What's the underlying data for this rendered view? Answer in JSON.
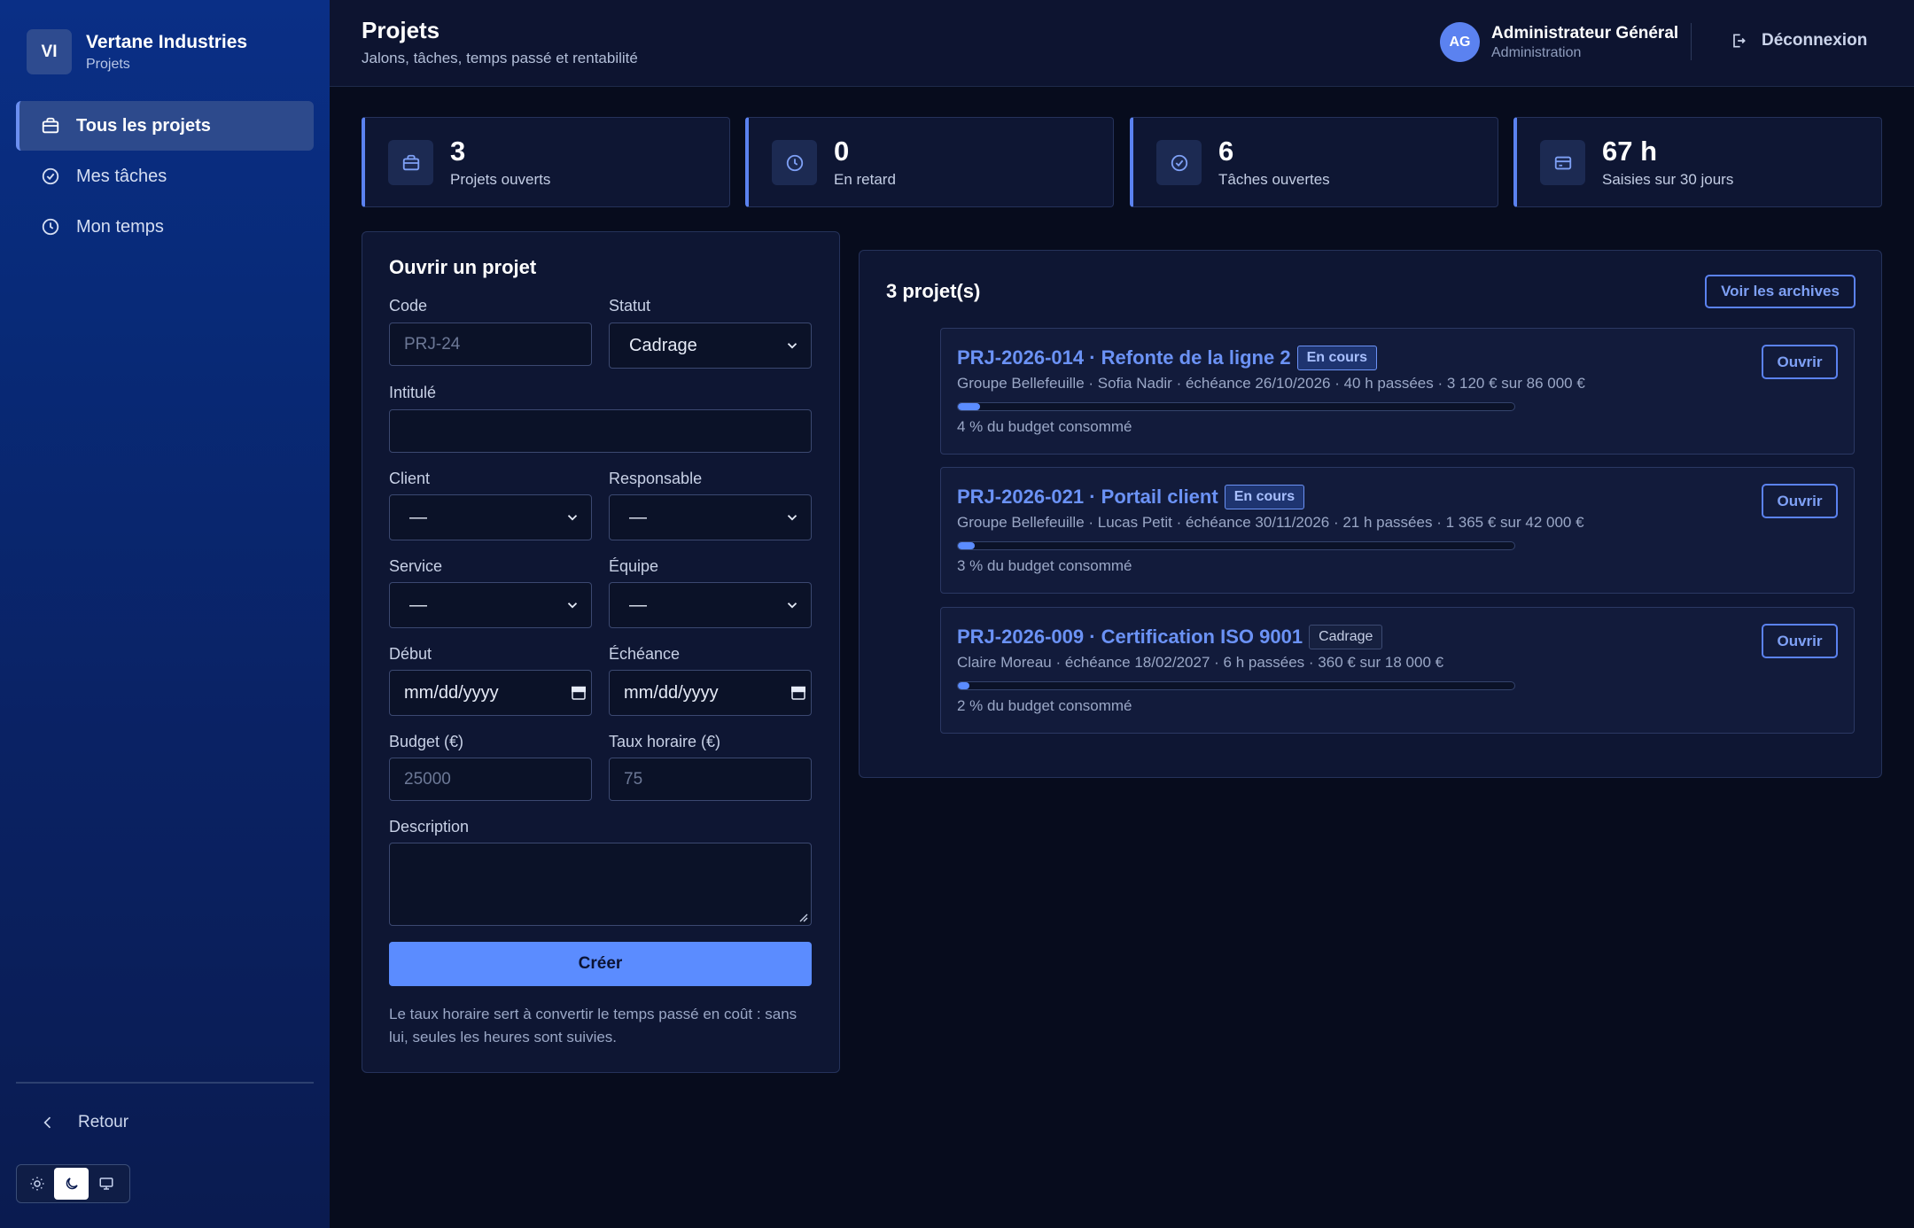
{
  "brand": {
    "initials": "VI",
    "name": "Vertane Industries",
    "subtitle": "Projets"
  },
  "sidebar": {
    "items": [
      {
        "label": "Tous les projets",
        "icon": "briefcase-icon",
        "active": true
      },
      {
        "label": "Mes tâches",
        "icon": "check-circle-icon",
        "active": false
      },
      {
        "label": "Mon temps",
        "icon": "clock-icon",
        "active": false
      }
    ],
    "back_label": "Retour",
    "theme": {
      "options": [
        "sun-icon",
        "moon-icon",
        "monitor-icon"
      ],
      "selected": "moon-icon"
    }
  },
  "header": {
    "title": "Projets",
    "subtitle": "Jalons, tâches, temps passé et rentabilité",
    "user": {
      "initials": "AG",
      "name": "Administrateur Général",
      "role": "Administration"
    },
    "logout_label": "Déconnexion"
  },
  "stats": [
    {
      "value": "3",
      "label": "Projets ouverts",
      "icon": "briefcase-icon"
    },
    {
      "value": "0",
      "label": "En retard",
      "icon": "clock-icon"
    },
    {
      "value": "6",
      "label": "Tâches ouvertes",
      "icon": "check-circle-icon"
    },
    {
      "value": "67 h",
      "label": "Saisies sur 30 jours",
      "icon": "card-icon"
    }
  ],
  "form": {
    "title": "Ouvrir un projet",
    "code": {
      "label": "Code",
      "placeholder": "PRJ-24",
      "value": ""
    },
    "status": {
      "label": "Statut",
      "value": "Cadrage"
    },
    "title_field": {
      "label": "Intitulé",
      "value": ""
    },
    "client": {
      "label": "Client",
      "value": "—"
    },
    "manager": {
      "label": "Responsable",
      "value": "—"
    },
    "service": {
      "label": "Service",
      "value": "—"
    },
    "team": {
      "label": "Équipe",
      "value": "—"
    },
    "start": {
      "label": "Début",
      "placeholder": "mm/dd/yyyy"
    },
    "due": {
      "label": "Échéance",
      "placeholder": "mm/dd/yyyy"
    },
    "budget": {
      "label": "Budget (€)",
      "placeholder": "25000"
    },
    "rate": {
      "label": "Taux horaire (€)",
      "placeholder": "75"
    },
    "description": {
      "label": "Description",
      "value": ""
    },
    "submit_label": "Créer",
    "note": "Le taux horaire sert à convertir le temps passé en coût : sans lui, seules les heures sont suivies."
  },
  "projects": {
    "count_label": "3 projet(s)",
    "archive_label": "Voir les archives",
    "open_label": "Ouvrir",
    "accent": "#5b8cff",
    "items": [
      {
        "title": "PRJ-2026-014 · Refonte de la ligne 2",
        "status": "En cours",
        "meta": "Groupe Bellefeuille · Sofia Nadir · échéance 26/10/2026 · 40 h passées · 3 120 € sur 86 000 €",
        "progress": 4,
        "budget_text": "4 % du budget consommé"
      },
      {
        "title": "PRJ-2026-021 · Portail client",
        "status": "En cours",
        "meta": "Groupe Bellefeuille · Lucas Petit · échéance 30/11/2026 · 21 h passées · 1 365 € sur 42 000 €",
        "progress": 3,
        "budget_text": "3 % du budget consommé"
      },
      {
        "title": "PRJ-2026-009 · Certification ISO 9001",
        "status": "Cadrage",
        "meta": "Claire Moreau · échéance 18/02/2027 · 6 h passées · 360 € sur 18 000 €",
        "progress": 2,
        "budget_text": "2 % du budget consommé"
      }
    ]
  }
}
